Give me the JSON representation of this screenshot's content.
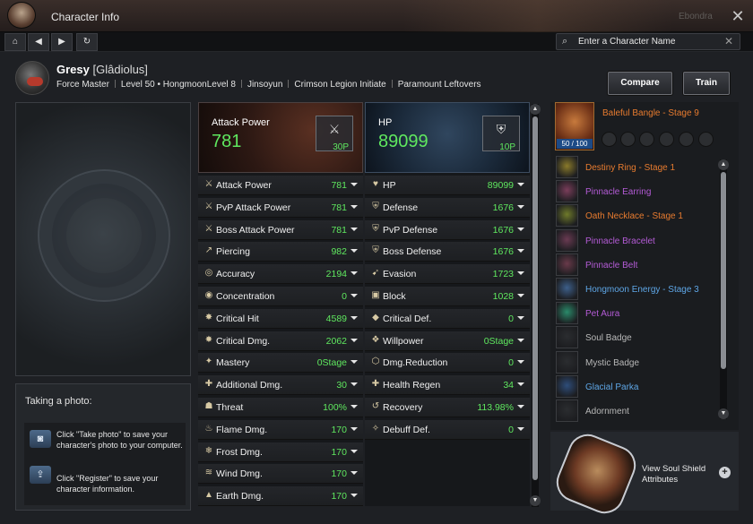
{
  "window": {
    "title": "Character Info",
    "user_label": "Ebondra",
    "close_label": "✕"
  },
  "nav": {
    "home": "⌂",
    "back": "◀",
    "forward": "▶",
    "refresh": "↻"
  },
  "search": {
    "placeholder": "Enter a Character Name",
    "icon": "search-icon",
    "clear": "✕"
  },
  "character": {
    "name": "Gresy",
    "alias": "[Glâdiolus]",
    "meta": [
      "Force Master",
      "Level 50 • HongmoonLevel 8",
      "Jinsoyun",
      "Crimson Legion Initiate",
      "Paramount Leftovers"
    ]
  },
  "buttons": {
    "compare": "Compare",
    "train": "Train"
  },
  "photo": {
    "title": "Taking a photo:",
    "tip1": "Click \"Take photo\" to save your character's photo to your computer.",
    "tip2": "Click \"Register\" to save your character information."
  },
  "attack": {
    "header_label": "Attack Power",
    "header_value": "781",
    "points": "30P",
    "rows": [
      {
        "icon": "⚔",
        "name": "Attack Power",
        "value": "781"
      },
      {
        "icon": "⚔",
        "name": "PvP Attack Power",
        "value": "781"
      },
      {
        "icon": "⚔",
        "name": "Boss Attack Power",
        "value": "781"
      },
      {
        "icon": "↗",
        "name": "Piercing",
        "value": "982"
      },
      {
        "icon": "◎",
        "name": "Accuracy",
        "value": "2194"
      },
      {
        "icon": "◉",
        "name": "Concentration",
        "value": "0"
      },
      {
        "icon": "✸",
        "name": "Critical Hit",
        "value": "4589"
      },
      {
        "icon": "✸",
        "name": "Critical Dmg.",
        "value": "2062"
      },
      {
        "icon": "✦",
        "name": "Mastery",
        "value": "0Stage"
      },
      {
        "icon": "✚",
        "name": "Additional Dmg.",
        "value": "30"
      },
      {
        "icon": "☗",
        "name": "Threat",
        "value": "100%"
      },
      {
        "icon": "♨",
        "name": "Flame Dmg.",
        "value": "170"
      },
      {
        "icon": "❄",
        "name": "Frost Dmg.",
        "value": "170"
      },
      {
        "icon": "≋",
        "name": "Wind Dmg.",
        "value": "170"
      },
      {
        "icon": "▲",
        "name": "Earth Dmg.",
        "value": "170"
      }
    ]
  },
  "defense": {
    "header_label": "HP",
    "header_value": "89099",
    "points": "10P",
    "rows": [
      {
        "icon": "♥",
        "name": "HP",
        "value": "89099"
      },
      {
        "icon": "⛨",
        "name": "Defense",
        "value": "1676"
      },
      {
        "icon": "⛨",
        "name": "PvP Defense",
        "value": "1676"
      },
      {
        "icon": "⛨",
        "name": "Boss Defense",
        "value": "1676"
      },
      {
        "icon": "➹",
        "name": "Evasion",
        "value": "1723"
      },
      {
        "icon": "▣",
        "name": "Block",
        "value": "1028"
      },
      {
        "icon": "◆",
        "name": "Critical Def.",
        "value": "0"
      },
      {
        "icon": "❖",
        "name": "Willpower",
        "value": "0Stage"
      },
      {
        "icon": "⬡",
        "name": "Dmg.Reduction",
        "value": "0"
      },
      {
        "icon": "✚",
        "name": "Health Regen",
        "value": "34"
      },
      {
        "icon": "↺",
        "name": "Recovery",
        "value": "113.98%"
      },
      {
        "icon": "✧",
        "name": "Debuff Def.",
        "value": "0"
      }
    ]
  },
  "equipment": {
    "bangle": {
      "name": "Baleful Bangle - Stage 9",
      "count": "50 / 100",
      "color": "#e77b2f"
    },
    "items": [
      {
        "name": "Destiny Ring - Stage 1",
        "color": "#e77b2f",
        "icon_color": "#8a7a2a"
      },
      {
        "name": "Pinnacle Earring",
        "color": "#b45bd6",
        "icon_color": "#7a3d5a"
      },
      {
        "name": "Oath Necklace - Stage 1",
        "color": "#e77b2f",
        "icon_color": "#6f7a2a"
      },
      {
        "name": "Pinnacle Bracelet",
        "color": "#b45bd6",
        "icon_color": "#6a3a52"
      },
      {
        "name": "Pinnacle Belt",
        "color": "#b45bd6",
        "icon_color": "#6a3a4a"
      },
      {
        "name": "Hongmoon Energy - Stage 3",
        "color": "#5ea6e6",
        "icon_color": "#3d5f8a"
      },
      {
        "name": "Pet Aura",
        "color": "#b45bd6",
        "icon_color": "#2a8a6a"
      },
      {
        "name": "Soul Badge",
        "color": "#b8b8b8",
        "icon_color": "#2b2d30"
      },
      {
        "name": "Mystic Badge",
        "color": "#b8b8b8",
        "icon_color": "#2b2d30"
      },
      {
        "name": "Glacial Parka",
        "color": "#5ea6e6",
        "icon_color": "#2e4d7a"
      },
      {
        "name": "Adornment",
        "color": "#b8b8b8",
        "icon_color": "#2b2d30"
      }
    ]
  },
  "soul_shield": {
    "label": "View Soul Shield Attributes",
    "plus": "+"
  },
  "colors": {
    "stat_value": "#5fe85f",
    "legendary": "#e77b2f",
    "heroic": "#b45bd6",
    "rare": "#5ea6e6"
  }
}
